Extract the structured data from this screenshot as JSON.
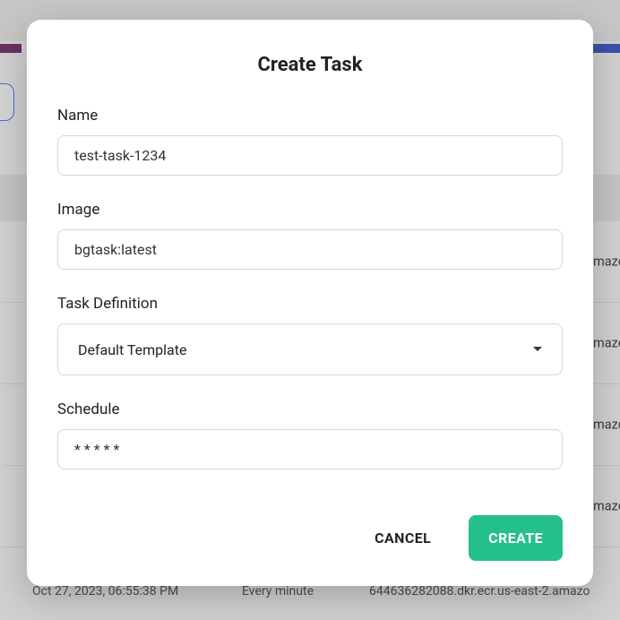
{
  "modal": {
    "title": "Create Task",
    "fields": {
      "name": {
        "label": "Name",
        "value": "test-task-1234"
      },
      "image": {
        "label": "Image",
        "value": "bgtask:latest"
      },
      "taskdef": {
        "label": "Task Definition",
        "value": "Default Template"
      },
      "schedule": {
        "label": "Schedule",
        "value": "* * * * *"
      }
    },
    "actions": {
      "cancel": "CANCEL",
      "create": "CREATE"
    }
  },
  "background": {
    "row_text": "amazo",
    "bottom": {
      "timestamp": "Oct 27, 2023, 06:55:38 PM",
      "schedule": "Every minute",
      "image": "644636282088.dkr.ecr.us-east-2.amazo"
    }
  }
}
